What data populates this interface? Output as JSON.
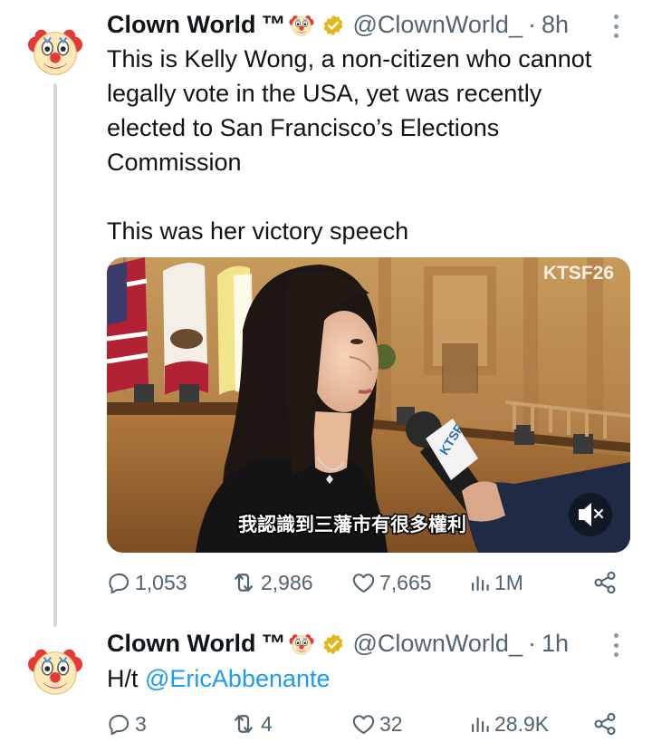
{
  "tweets": [
    {
      "name": "Clown World",
      "tm": "™",
      "handle": "@ClownWorld_",
      "time": "8h",
      "text_lines": [
        "This is Kelly Wong, a non-citizen who cannot",
        "legally vote in the USA, yet was recently",
        "elected to San Francisco’s Elections",
        "Commission"
      ],
      "text_line2": "This was her victory speech",
      "media": {
        "watermark": "KTSF26",
        "subtitle": "我認識到三藩市有很多權利",
        "mic_label": "KTSF",
        "mute_icon": "speaker-muted-icon"
      },
      "stats": {
        "replies": "1,053",
        "reposts": "2,986",
        "likes": "7,665",
        "views": "1M"
      }
    },
    {
      "name": "Clown World",
      "tm": "™",
      "handle": "@ClownWorld_",
      "time": "1h",
      "text_prefix": "H/t ",
      "mention": "@EricAbbenante",
      "stats": {
        "replies": "3",
        "reposts": "4",
        "likes": "32",
        "views": "28.9K"
      }
    }
  ],
  "colors": {
    "accent": "#1d9bf0",
    "muted": "#536471",
    "verified": "#e2b719",
    "thread": "#cfd9de"
  }
}
